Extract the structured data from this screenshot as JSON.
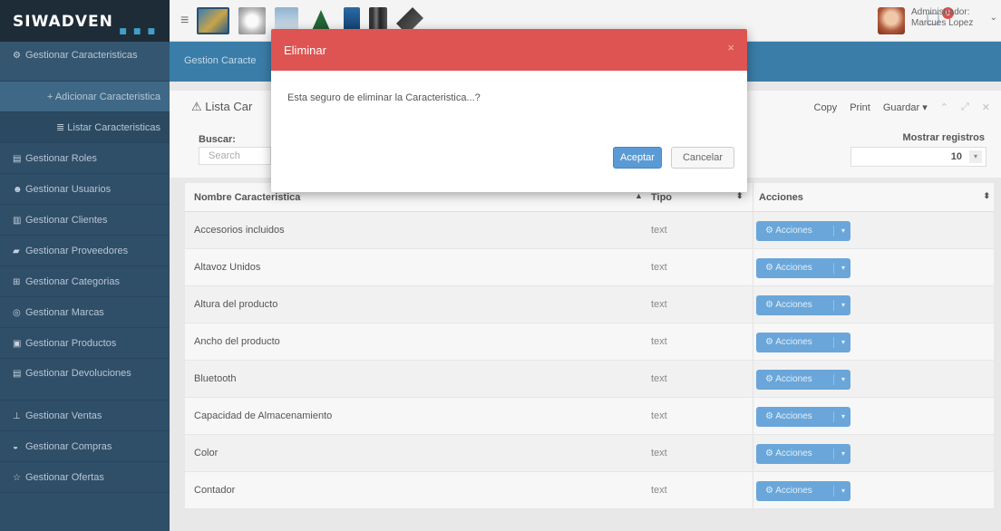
{
  "app": {
    "logo": "SIWADVEN",
    "logo_dots": "■ ■ ■"
  },
  "header": {
    "menu_icon": "hamburger-icon",
    "thumbnails": [
      "monitor-image",
      "speaker-image",
      "phone-image",
      "tent-image",
      "tablet-image",
      "keyboard-image",
      "camera-image"
    ],
    "notification_count": "0",
    "user_role": "Administrador:",
    "user_name": "Marcues Lopez"
  },
  "sidebar": {
    "items": [
      {
        "icon": "gears-icon",
        "label": "Gestionar Caracteristicas"
      },
      {
        "icon": "plus-icon",
        "label": "+ Adicionar Caracteristica",
        "sub": true
      },
      {
        "icon": "list-icon",
        "label": "≣ Listar Caracteristicas",
        "sub": true,
        "active": true
      },
      {
        "icon": "table-icon",
        "label": "Gestionar Roles"
      },
      {
        "icon": "users-icon",
        "label": "Gestionar Usuarios"
      },
      {
        "icon": "building-icon",
        "label": "Gestionar Clientes"
      },
      {
        "icon": "truck-icon",
        "label": "Gestionar Proveedores"
      },
      {
        "icon": "sitemap-icon",
        "label": "Gestionar Categorias"
      },
      {
        "icon": "badge-icon",
        "label": "Gestionar Marcas"
      },
      {
        "icon": "box-icon",
        "label": "Gestionar Productos"
      },
      {
        "icon": "file-icon",
        "label": "Gestionar Devoluciones"
      },
      {
        "icon": "cart-icon",
        "label": "Gestionar Ventas"
      },
      {
        "icon": "bag-icon",
        "label": "Gestionar Compras"
      },
      {
        "icon": "star-icon",
        "label": "Gestionar Ofertas"
      }
    ]
  },
  "breadcrumb": "Gestion Caracte",
  "panel": {
    "title": "Lista Car",
    "tools": {
      "copy": "Copy",
      "print": "Print",
      "save": "Guardar ▾"
    },
    "search_label": "Buscar:",
    "search_placeholder": "Search",
    "show_label": "Mostrar registros",
    "show_value": "10"
  },
  "table": {
    "headers": {
      "name": "Nombre Caracteristica",
      "type": "Tipo",
      "actions": "Acciones"
    },
    "action_label": "Acciones",
    "rows": [
      {
        "name": "Accesorios incluidos",
        "type": "text"
      },
      {
        "name": "Altavoz Unidos",
        "type": "text"
      },
      {
        "name": "Altura del producto",
        "type": "text"
      },
      {
        "name": "Ancho del producto",
        "type": "text"
      },
      {
        "name": "Bluetooth",
        "type": "text"
      },
      {
        "name": "Capacidad de Almacenamiento",
        "type": "text"
      },
      {
        "name": "Color",
        "type": "text"
      },
      {
        "name": "Contador",
        "type": "text"
      }
    ]
  },
  "modal": {
    "title": "Eliminar",
    "message": "Esta seguro de eliminar la Caracteristica...?",
    "confirm": "Aceptar",
    "cancel": "Cancelar",
    "header_color": "#dd5452"
  }
}
